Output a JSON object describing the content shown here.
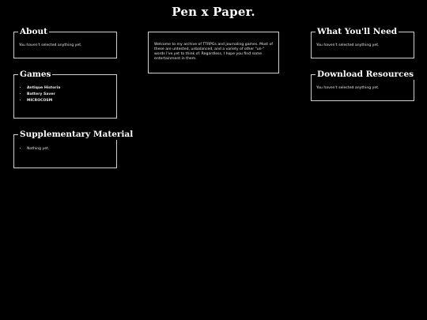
{
  "site_title": "Pen x Paper.",
  "intro": {
    "text": "Welcome to my archive of TTRPGs and journaling games. Most of these are untested, unbalanced, and a variety of other \"un-\" words I've yet to think of. Regardless, I hope you find some entertainment in them."
  },
  "about": {
    "title": "About",
    "text": "You haven't selected anything yet."
  },
  "games": {
    "title": "Games",
    "items": [
      "Antique Historia",
      "Battery Saver",
      "MICROCOSM"
    ]
  },
  "supplementary": {
    "title": "Supplementary Material",
    "items": [
      "Nothing yet."
    ]
  },
  "what_you_need": {
    "title": "What You'll Need",
    "text": "You haven't selected anything yet."
  },
  "download_resources": {
    "title": "Download Resources",
    "text": "You haven't selected anything yet."
  }
}
